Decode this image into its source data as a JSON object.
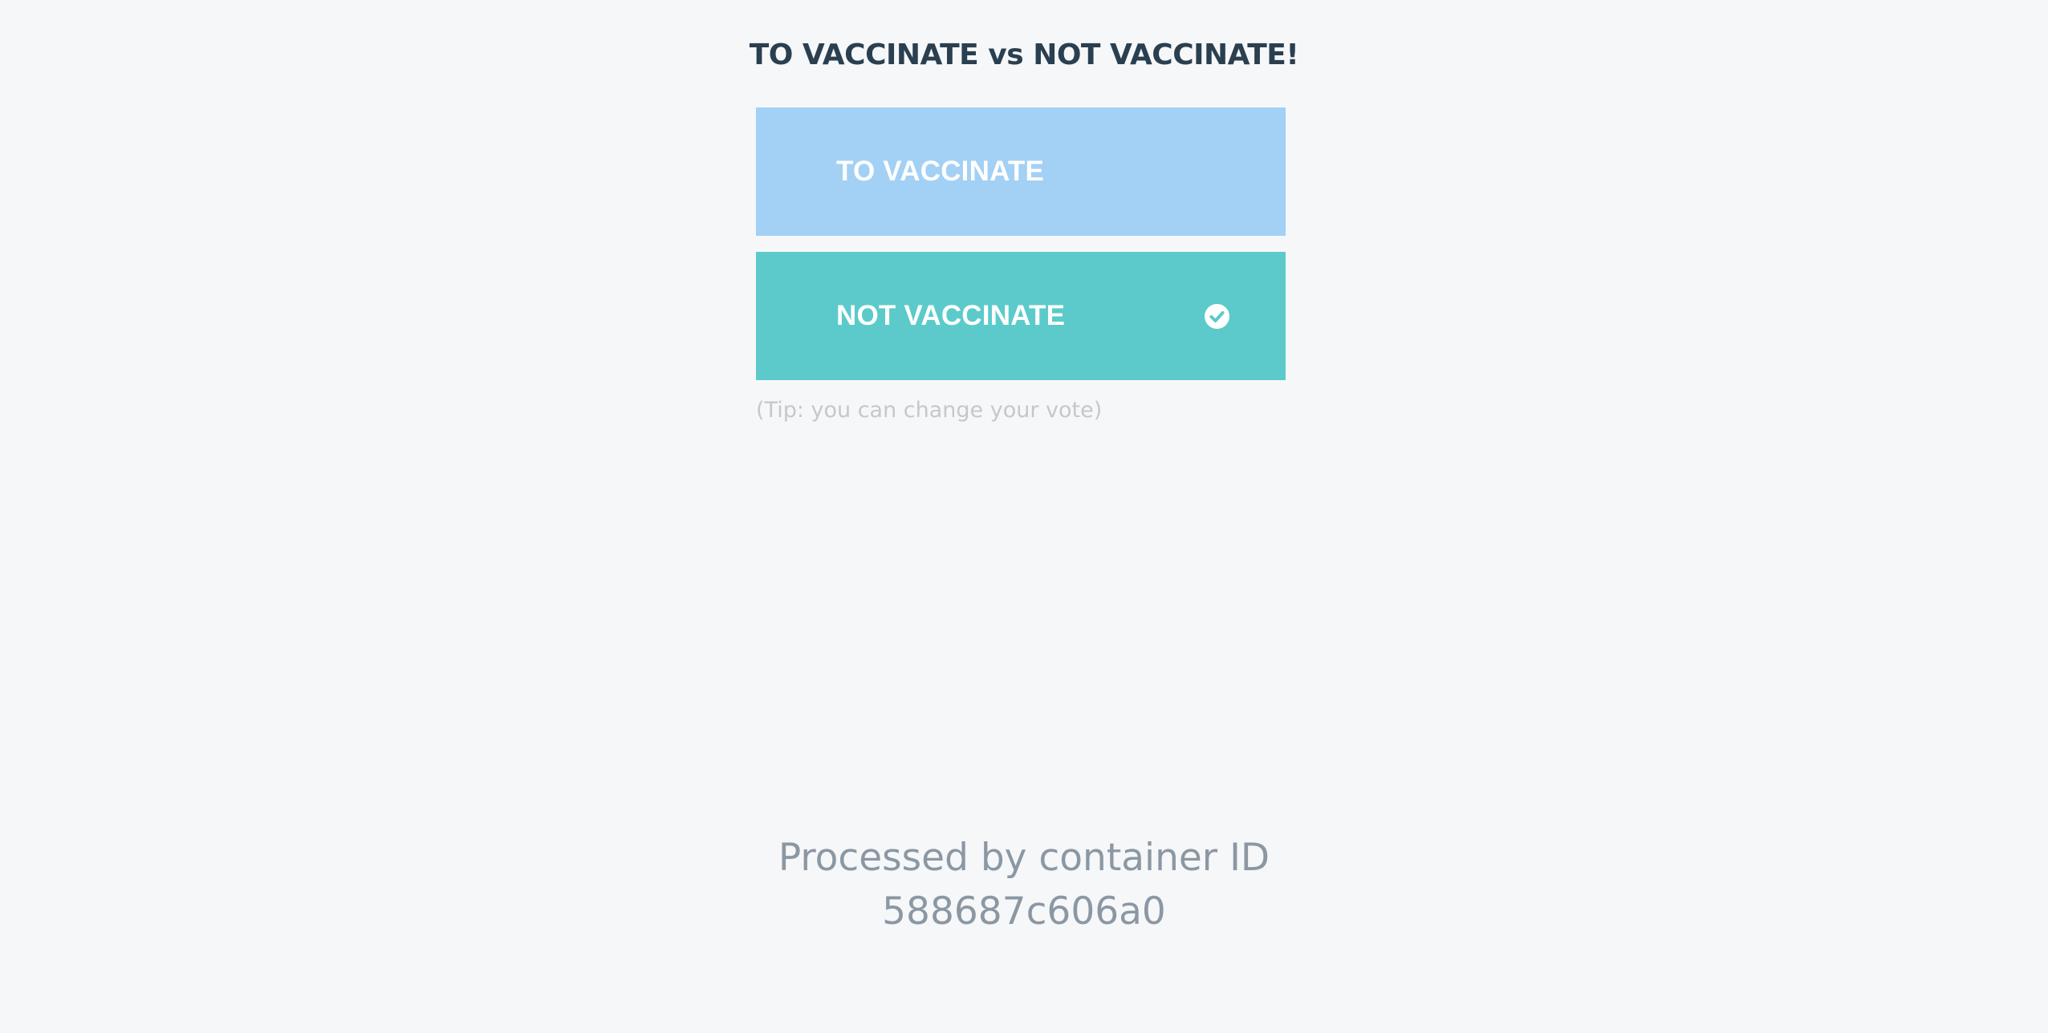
{
  "page": {
    "title": "TO VACCINATE vs NOT VACCINATE!"
  },
  "options": [
    {
      "label": "TO VACCINATE",
      "selected": false,
      "color": "#a3d0f5"
    },
    {
      "label": "NOT VACCINATE",
      "selected": true,
      "color": "#5ccaca"
    }
  ],
  "tip": "(Tip: you can change your vote)",
  "footer": {
    "line1": "Processed by container ID",
    "line2": "588687c606a0"
  },
  "icons": {
    "selected_indicator": "check-circle-icon"
  }
}
